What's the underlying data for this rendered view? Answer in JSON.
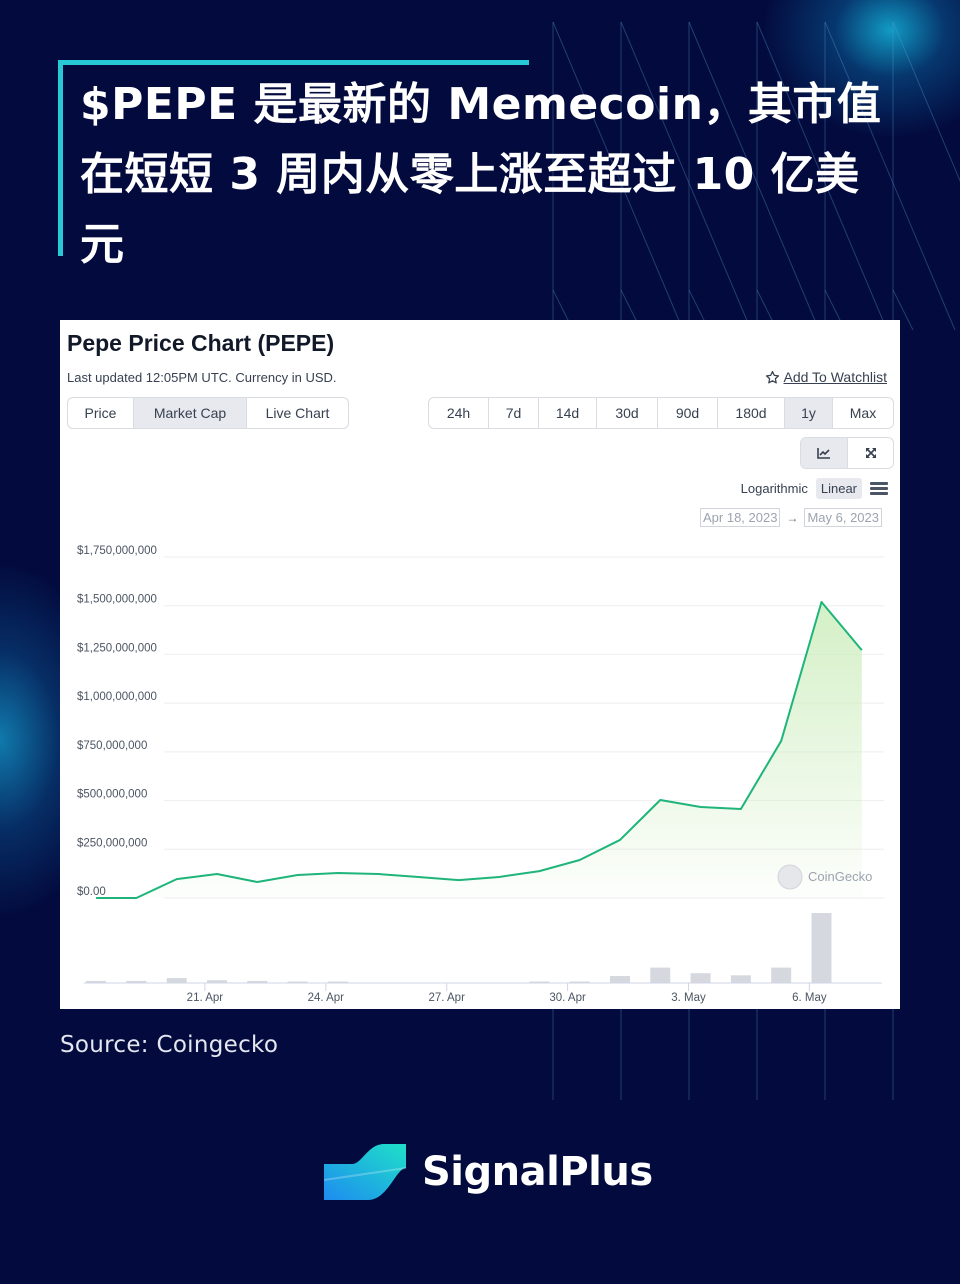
{
  "headline": "$PEPE 是最新的 Memecoin，其市值在短短 3 周内从零上涨至超过 10 亿美元",
  "card": {
    "title": "Pepe Price Chart (PEPE)",
    "subtitle": "Last updated 12:05PM UTC. Currency in USD.",
    "watchlist_label": "Add To Watchlist",
    "type_tabs": [
      {
        "label": "Price",
        "active": false
      },
      {
        "label": "Market Cap",
        "active": true
      },
      {
        "label": "Live Chart",
        "active": false
      }
    ],
    "range_tabs": [
      {
        "label": "24h",
        "active": false
      },
      {
        "label": "7d",
        "active": false
      },
      {
        "label": "14d",
        "active": false
      },
      {
        "label": "30d",
        "active": false
      },
      {
        "label": "90d",
        "active": false
      },
      {
        "label": "180d",
        "active": false
      },
      {
        "label": "1y",
        "active": true
      },
      {
        "label": "Max",
        "active": false
      }
    ],
    "view_buttons": [
      {
        "icon": "line-chart-icon",
        "active": true
      },
      {
        "icon": "fullscreen-icon",
        "active": false
      }
    ],
    "scale_options": {
      "logarithmic": "Logarithmic",
      "linear": "Linear",
      "selected": "Linear"
    },
    "date_from": "Apr 18, 2023",
    "date_to": "May 6, 2023",
    "date_arrow": "→",
    "watermark": "CoinGecko"
  },
  "colors": {
    "background": "#030a3d",
    "accent": "#27c9d6",
    "line": "#1fb57a",
    "fill": "#cfeec0",
    "volume_bar": "#d5d8de",
    "grid": "#eeeeee"
  },
  "chart_data": {
    "type": "line",
    "title": "Pepe Price Chart (PEPE) — Market Cap",
    "xlabel": "",
    "ylabel": "Market Cap (USD)",
    "ylim": [
      0,
      1750000000
    ],
    "yticks": [
      0,
      250000000,
      500000000,
      750000000,
      1000000000,
      1250000000,
      1500000000,
      1750000000
    ],
    "ytick_labels": [
      "$0.00",
      "$250,000,000",
      "$500,000,000",
      "$750,000,000",
      "$1,000,000,000",
      "$1,250,000,000",
      "$1,500,000,000",
      "$1,750,000,000"
    ],
    "xlim_days": [
      0,
      19.5
    ],
    "xticks_days": [
      3,
      6,
      9,
      12,
      15,
      18
    ],
    "xtick_labels": [
      "21. Apr",
      "24. Apr",
      "27. Apr",
      "30. Apr",
      "3. May",
      "6. May"
    ],
    "grid": true,
    "legend": "none",
    "series": [
      {
        "name": "Market Cap",
        "x_days": [
          0.3,
          1.3,
          2.3,
          3.3,
          4.3,
          5.3,
          6.3,
          7.3,
          8.3,
          9.3,
          10.3,
          11.3,
          12.3,
          13.3,
          14.3,
          15.3,
          16.3,
          17.3,
          18.3,
          19.3
        ],
        "values": [
          0,
          0,
          97000000,
          123000000,
          82000000,
          118000000,
          128000000,
          123000000,
          108000000,
          92000000,
          108000000,
          138000000,
          195000000,
          298000000,
          503000000,
          467000000,
          457000000,
          806000000,
          1519000000,
          1272000000
        ]
      },
      {
        "name": "Volume (relative)",
        "x_days": [
          0.3,
          1.3,
          2.3,
          3.3,
          4.3,
          5.3,
          6.3,
          7.3,
          8.3,
          9.3,
          10.3,
          11.3,
          12.3,
          13.3,
          14.3,
          15.3,
          16.3,
          17.3,
          18.3,
          19.3
        ],
        "values": [
          0.03,
          0.03,
          0.07,
          0.04,
          0.03,
          0.01,
          0.01,
          0,
          0,
          0,
          0,
          0.01,
          0.01,
          0.1,
          0.22,
          0.14,
          0.11,
          0.22,
          1.0,
          0
        ]
      }
    ]
  },
  "source": "Source: Coingecko",
  "brand": {
    "name": "SignalPlus"
  }
}
